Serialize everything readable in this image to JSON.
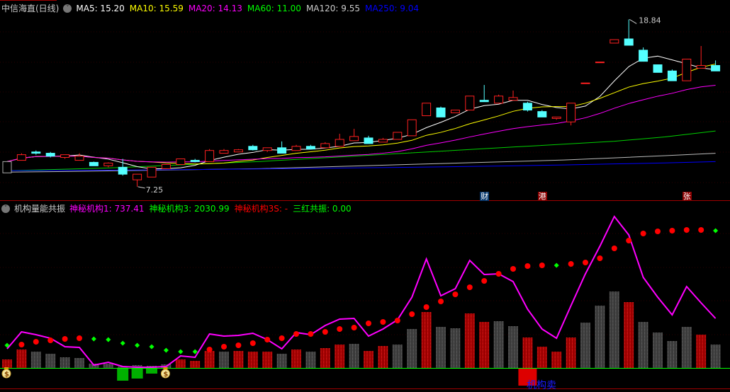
{
  "main": {
    "title": "中信海直(日线)",
    "ma_labels": [
      {
        "text": "MA5: 15.20",
        "color": "#ffffff"
      },
      {
        "text": "MA10: 15.59",
        "color": "#ffff00"
      },
      {
        "text": "MA20: 14.13",
        "color": "#ff00ff"
      },
      {
        "text": "MA60: 11.00",
        "color": "#00ff00"
      },
      {
        "text": "MA120: 9.55",
        "color": "#cccccc"
      },
      {
        "text": "MA250: 9.04",
        "color": "#0000ff"
      }
    ],
    "high_label": "18.84",
    "low_label": "7.25",
    "price_range": [
      7.0,
      19.5
    ],
    "candles": [
      [
        8.21,
        8.99,
        8.21,
        8.99
      ],
      [
        9.08,
        9.57,
        9.08,
        9.47
      ],
      [
        9.66,
        9.76,
        9.47,
        9.57
      ],
      [
        9.57,
        9.66,
        9.28,
        9.37
      ],
      [
        9.28,
        9.47,
        9.18,
        9.47
      ],
      [
        9.08,
        9.57,
        9.08,
        9.37
      ],
      [
        8.94,
        8.99,
        8.7,
        8.7
      ],
      [
        8.7,
        8.94,
        8.6,
        8.89
      ],
      [
        8.6,
        9.18,
        8.02,
        8.12
      ],
      [
        7.73,
        8.12,
        7.25,
        8.12
      ],
      [
        7.92,
        8.6,
        7.92,
        8.6
      ],
      [
        8.5,
        8.79,
        8.5,
        8.79
      ],
      [
        8.79,
        9.18,
        8.79,
        9.18
      ],
      [
        9.08,
        9.18,
        8.94,
        8.99
      ],
      [
        8.99,
        9.86,
        8.99,
        9.76
      ],
      [
        9.57,
        9.86,
        9.57,
        9.76
      ],
      [
        9.66,
        9.86,
        9.66,
        9.81
      ],
      [
        10.05,
        10.15,
        9.76,
        9.81
      ],
      [
        9.76,
        9.95,
        9.66,
        9.95
      ],
      [
        9.95,
        10.39,
        9.57,
        9.57
      ],
      [
        9.76,
        10.15,
        9.76,
        10.05
      ],
      [
        10.05,
        10.15,
        9.86,
        9.86
      ],
      [
        9.95,
        10.34,
        9.95,
        10.24
      ],
      [
        10.05,
        10.92,
        10.05,
        10.53
      ],
      [
        10.44,
        11.26,
        10.44,
        10.73
      ],
      [
        10.63,
        10.78,
        10.24,
        10.24
      ],
      [
        10.34,
        10.63,
        10.34,
        10.53
      ],
      [
        10.53,
        11.02,
        10.53,
        11.02
      ],
      [
        10.78,
        11.89,
        10.78,
        11.89
      ],
      [
        12.17,
        13.04,
        12.17,
        13.04
      ],
      [
        12.71,
        12.8,
        12.08,
        12.08
      ],
      [
        12.37,
        12.56,
        12.37,
        12.56
      ],
      [
        12.56,
        13.53,
        12.56,
        13.53
      ],
      [
        13.24,
        14.3,
        13.14,
        13.14
      ],
      [
        13.04,
        13.63,
        13.04,
        13.53
      ],
      [
        13.24,
        13.91,
        13.24,
        13.43
      ],
      [
        13.04,
        13.14,
        12.46,
        12.56
      ],
      [
        12.46,
        12.56,
        12.08,
        12.08
      ],
      [
        11.98,
        12.08,
        11.89,
        12.08
      ],
      [
        11.74,
        13.04,
        11.5,
        13.04
      ],
      [
        14.44,
        14.44,
        14.44,
        14.44
      ],
      [
        15.89,
        15.89,
        15.89,
        15.89
      ],
      [
        17.2,
        17.44,
        17.2,
        17.44
      ],
      [
        17.49,
        18.84,
        17.05,
        17.05
      ],
      [
        16.71,
        16.9,
        15.94,
        15.94
      ],
      [
        15.7,
        15.7,
        15.17,
        15.17
      ],
      [
        15.27,
        15.37,
        14.59,
        14.59
      ],
      [
        14.59,
        16.09,
        14.59,
        16.09
      ],
      [
        15.46,
        17.0,
        15.46,
        15.65
      ],
      [
        15.65,
        16.0,
        15.27,
        15.27
      ]
    ],
    "ma_long": {
      "ma60": [
        8.36,
        8.45,
        8.55,
        8.7,
        8.85,
        9.0,
        9.2,
        9.4,
        9.6,
        9.8,
        10.0,
        10.2,
        10.4,
        10.7,
        11.11
      ],
      "ma120": [
        8.26,
        8.3,
        8.35,
        8.4,
        8.45,
        8.5,
        8.6,
        8.7,
        8.8,
        8.9,
        9.0,
        9.1,
        9.25,
        9.4,
        9.57
      ],
      "ma250": [
        8.36,
        8.38,
        8.4,
        8.42,
        8.45,
        8.48,
        8.52,
        8.56,
        8.6,
        8.65,
        8.7,
        8.76,
        8.83,
        8.9,
        8.99
      ]
    },
    "event_marks": [
      {
        "text": "财",
        "index": 33,
        "color": "#0a3a6e"
      },
      {
        "text": "港",
        "index": 37,
        "color": "#8b0000"
      },
      {
        "text": "张",
        "index": 47,
        "color": "#8b0000"
      }
    ]
  },
  "sub": {
    "title": "机构量能共振",
    "labels": [
      {
        "text": "神秘机构1: 737.41",
        "color": "#ff00ff"
      },
      {
        "text": "神秘机构3: 2030.99",
        "color": "#00ff00"
      },
      {
        "text": "神秘机构3S: -",
        "color": "#ff0000"
      },
      {
        "text": "三红共振: 0.00",
        "color": "#00ff00"
      }
    ],
    "value_range": [
      -350,
      2150
    ],
    "line": [
      270,
      510,
      470,
      420,
      300,
      290,
      40,
      80,
      20,
      10,
      10,
      20,
      170,
      150,
      480,
      450,
      460,
      490,
      400,
      270,
      500,
      470,
      600,
      690,
      700,
      450,
      550,
      680,
      1000,
      1540,
      1020,
      1120,
      1520,
      1320,
      1330,
      1220,
      830,
      550,
      420,
      880,
      1330,
      1720,
      2140,
      1880,
      1280,
      1000,
      750,
      1150,
      920,
      700
    ],
    "dots": [
      [
        320,
        "g"
      ],
      [
        330,
        "r"
      ],
      [
        370,
        "r"
      ],
      [
        390,
        "r"
      ],
      [
        410,
        "r"
      ],
      [
        420,
        "r"
      ],
      [
        410,
        "g"
      ],
      [
        400,
        "g"
      ],
      [
        350,
        "g"
      ],
      [
        320,
        "g"
      ],
      [
        300,
        "g"
      ],
      [
        250,
        "g"
      ],
      [
        230,
        "g"
      ],
      [
        230,
        "g"
      ],
      [
        260,
        "r"
      ],
      [
        300,
        "r"
      ],
      [
        320,
        "r"
      ],
      [
        350,
        "r"
      ],
      [
        400,
        "r"
      ],
      [
        420,
        "r"
      ],
      [
        480,
        "r"
      ],
      [
        480,
        "r"
      ],
      [
        510,
        "r"
      ],
      [
        550,
        "r"
      ],
      [
        570,
        "r"
      ],
      [
        630,
        "r"
      ],
      [
        650,
        "r"
      ],
      [
        670,
        "r"
      ],
      [
        760,
        "r"
      ],
      [
        860,
        "r"
      ],
      [
        940,
        "r"
      ],
      [
        1040,
        "r"
      ],
      [
        1140,
        "r"
      ],
      [
        1230,
        "r"
      ],
      [
        1330,
        "r"
      ],
      [
        1400,
        "r"
      ],
      [
        1440,
        "r"
      ],
      [
        1450,
        "r"
      ],
      [
        1450,
        "g"
      ],
      [
        1470,
        "r"
      ],
      [
        1490,
        "r"
      ],
      [
        1550,
        "r"
      ],
      [
        1690,
        "r"
      ],
      [
        1800,
        "r"
      ],
      [
        1900,
        "r"
      ],
      [
        1930,
        "r"
      ],
      [
        1940,
        "r"
      ],
      [
        1950,
        "r"
      ],
      [
        1950,
        "r"
      ],
      [
        1940,
        "g"
      ]
    ],
    "bars": [
      [
        120,
        "r"
      ],
      [
        260,
        "r"
      ],
      [
        230,
        "g"
      ],
      [
        200,
        "g"
      ],
      [
        150,
        "g"
      ],
      [
        140,
        "g"
      ],
      [
        60,
        "g"
      ],
      [
        60,
        "g"
      ],
      [
        20,
        "g"
      ],
      [
        40,
        "g"
      ],
      [
        30,
        "g"
      ],
      [
        50,
        "g"
      ],
      [
        120,
        "r"
      ],
      [
        100,
        "r"
      ],
      [
        240,
        "r"
      ],
      [
        230,
        "g"
      ],
      [
        240,
        "r"
      ],
      [
        230,
        "r"
      ],
      [
        230,
        "r"
      ],
      [
        200,
        "g"
      ],
      [
        260,
        "r"
      ],
      [
        230,
        "g"
      ],
      [
        280,
        "r"
      ],
      [
        330,
        "r"
      ],
      [
        340,
        "g"
      ],
      [
        240,
        "r"
      ],
      [
        310,
        "r"
      ],
      [
        330,
        "g"
      ],
      [
        550,
        "g"
      ],
      [
        790,
        "r"
      ],
      [
        580,
        "g"
      ],
      [
        560,
        "g"
      ],
      [
        770,
        "r"
      ],
      [
        650,
        "r"
      ],
      [
        660,
        "g"
      ],
      [
        590,
        "g"
      ],
      [
        430,
        "r"
      ],
      [
        300,
        "r"
      ],
      [
        230,
        "r"
      ],
      [
        430,
        "r"
      ],
      [
        640,
        "g"
      ],
      [
        880,
        "g"
      ],
      [
        1080,
        "g"
      ],
      [
        930,
        "r"
      ],
      [
        650,
        "g"
      ],
      [
        500,
        "g"
      ],
      [
        380,
        "g"
      ],
      [
        580,
        "g"
      ],
      [
        470,
        "r"
      ],
      [
        330,
        "g"
      ]
    ],
    "neg_bars": [
      [
        8,
        -180
      ],
      [
        9,
        -150
      ],
      [
        10,
        -80
      ]
    ],
    "sell_block": {
      "index": 36,
      "value": -250
    },
    "sell_label": "机构卖",
    "money_bag_indices": [
      0,
      11
    ],
    "money_bag_glyph": "$"
  },
  "colors": {
    "up": "#ff2020",
    "down": "#54ffff",
    "border": "#a00000",
    "zero": "#00ff00",
    "magenta": "#ff00ff",
    "dot_red": "#ff0000",
    "dot_green": "#00ff00"
  }
}
